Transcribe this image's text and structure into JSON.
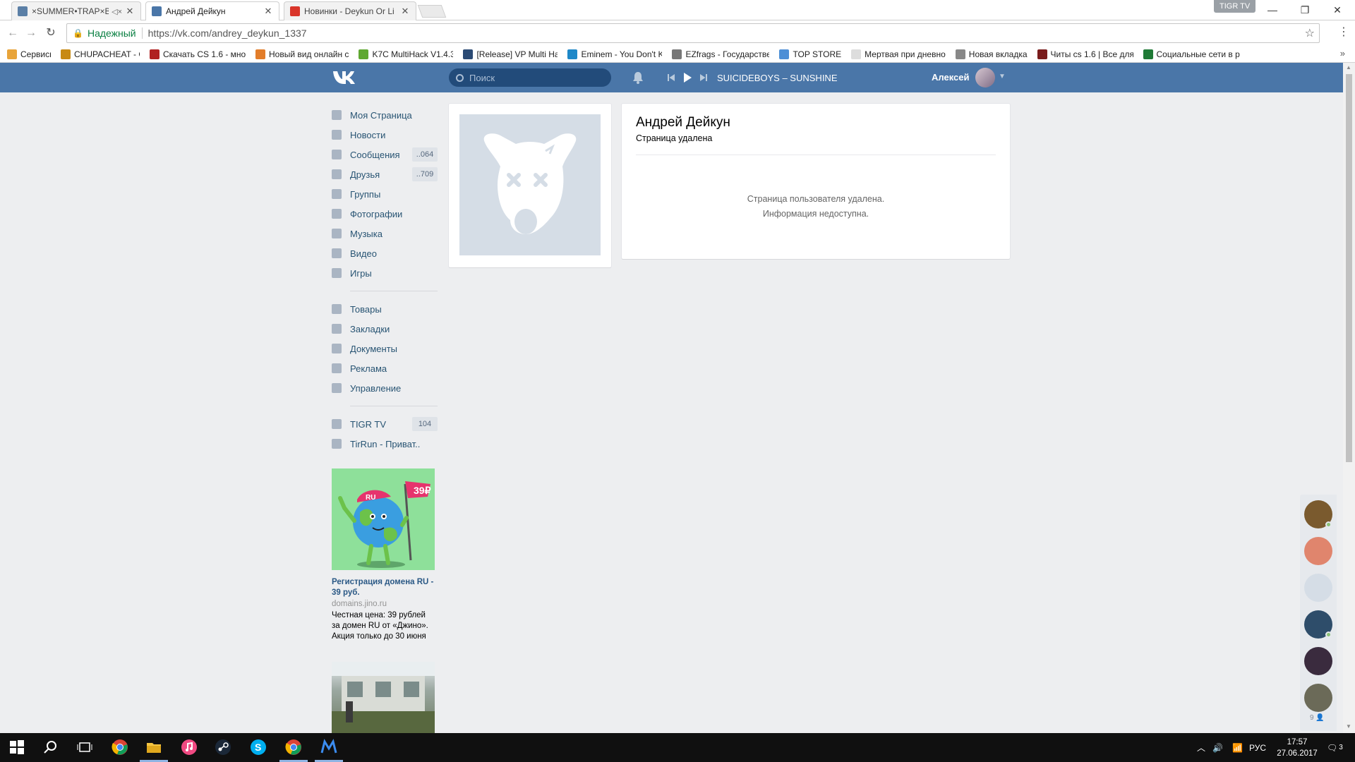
{
  "browser": {
    "tabs": [
      {
        "title": "×SUMMER•TRAP×BE",
        "favicon_color": "#5b7fa6",
        "muted": true
      },
      {
        "title": "Андрей Дейкун",
        "favicon_color": "#4a76a8",
        "muted": false
      },
      {
        "title": "Новинки - Deykun Or Li",
        "favicon_color": "#d9352a",
        "muted": false
      }
    ],
    "profile_badge": "TIGR TV",
    "address": {
      "security_label": "Надежный",
      "url": "https://vk.com/andrey_deykun_1337"
    },
    "bookmarks": [
      {
        "label": "Сервисы",
        "color": "#e8a43a",
        "width": 62
      },
      {
        "label": "CHUPACHEAT - СЛАД",
        "color": "#c88a12",
        "width": 112
      },
      {
        "label": "Скачать CS 1.6 - мно",
        "color": "#b02121",
        "width": 136
      },
      {
        "label": "Новый вид онлайн с",
        "color": "#e27d2a",
        "width": 138
      },
      {
        "label": "K7C MultiHack V1.4.3",
        "color": "#5fa831",
        "width": 134
      },
      {
        "label": "[Release] VP Multi Ha",
        "color": "#2b4a74",
        "width": 134
      },
      {
        "label": "Eminem - You Don't K",
        "color": "#1e88c8",
        "width": 134
      },
      {
        "label": "EZfrags - Государстве",
        "color": "#777777",
        "width": 138
      },
      {
        "label": "TOP STORE",
        "color": "#4d8fd6",
        "width": 90
      },
      {
        "label": "Мертвая при дневно",
        "color": "#dddddd",
        "width": 138
      },
      {
        "label": "Новая вкладка",
        "color": "#888888",
        "width": 108
      },
      {
        "label": "Читы cs 1.6 | Все для",
        "color": "#7a1c1c",
        "width": 136
      },
      {
        "label": "Социальные сети в р",
        "color": "#1f7a36",
        "width": 140
      }
    ]
  },
  "header": {
    "search_placeholder": "Поиск",
    "now_playing": "SUICIDEBOYS – SUNSHINE",
    "user_name": "Алексей",
    "accent_color": "#4a76a8"
  },
  "menu": {
    "main": [
      {
        "label": "Моя Страница",
        "icon": "home-icon",
        "badge": ""
      },
      {
        "label": "Новости",
        "icon": "news-icon",
        "badge": ""
      },
      {
        "label": "Сообщения",
        "icon": "messages-icon",
        "badge": "..064"
      },
      {
        "label": "Друзья",
        "icon": "friends-icon",
        "badge": "..709"
      },
      {
        "label": "Группы",
        "icon": "groups-icon",
        "badge": ""
      },
      {
        "label": "Фотографии",
        "icon": "camera-icon",
        "badge": ""
      },
      {
        "label": "Музыка",
        "icon": "music-icon",
        "badge": ""
      },
      {
        "label": "Видео",
        "icon": "video-icon",
        "badge": ""
      },
      {
        "label": "Игры",
        "icon": "games-icon",
        "badge": ""
      }
    ],
    "extra": [
      {
        "label": "Товары",
        "icon": "bag-icon",
        "badge": ""
      },
      {
        "label": "Закладки",
        "icon": "star-icon",
        "badge": ""
      },
      {
        "label": "Документы",
        "icon": "document-icon",
        "badge": ""
      },
      {
        "label": "Реклама",
        "icon": "megaphone-icon",
        "badge": ""
      },
      {
        "label": "Управление",
        "icon": "gamepad-icon",
        "badge": ""
      }
    ],
    "communities": [
      {
        "label": "TIGR TV",
        "icon": "community-icon",
        "badge": "104"
      },
      {
        "label": "TirRun - Приват..",
        "icon": "community-icon",
        "badge": ""
      }
    ]
  },
  "ad": {
    "flag_text": "39₽",
    "cap_text": "RU",
    "title": "Регистрация домена RU - 39 руб.",
    "domain": "domains.jino.ru",
    "description": "Честная цена: 39 рублей за домен RU от «Джино». Акция только до 30 июня"
  },
  "profile": {
    "name": "Андрей Дейкун",
    "status": "Страница удалена",
    "message_line1": "Страница пользователя удалена.",
    "message_line2": "Информация недоступна."
  },
  "chats": {
    "avatars": [
      {
        "color": "#7a5a2e",
        "online": true
      },
      {
        "color": "#e0856d",
        "online": false
      },
      {
        "color": "#d5dde6",
        "online": false
      },
      {
        "color": "#2e4d6a",
        "online": true
      },
      {
        "color": "#3a2b3e",
        "online": false
      },
      {
        "color": "#6b6a58",
        "online": false
      }
    ],
    "count": "9"
  },
  "taskbar": {
    "language": "РУС",
    "time": "17:57",
    "date": "27.06.2017",
    "notifications": "3"
  }
}
